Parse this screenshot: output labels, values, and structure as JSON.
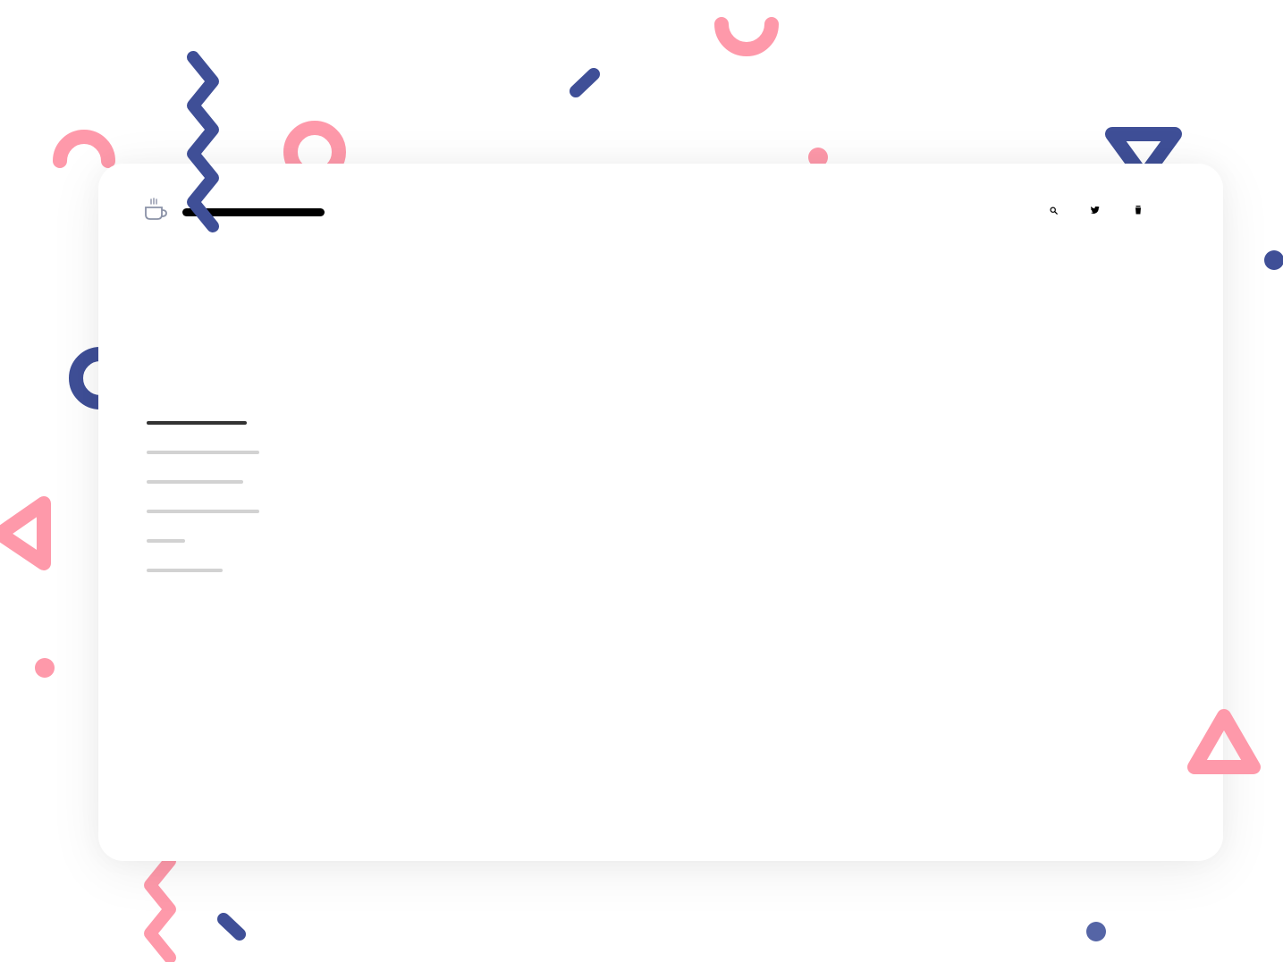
{
  "app": {
    "logo_icon": "coffee-cup-icon",
    "title_placeholder": "redacted title bar"
  },
  "header": {
    "icons": [
      "search-icon",
      "twitter-icon",
      "coffee-cup-icon"
    ]
  },
  "menu": {
    "items": [
      {
        "name": "menu-item-1",
        "state": "active"
      },
      {
        "name": "menu-item-2",
        "state": "inactive"
      },
      {
        "name": "menu-item-3",
        "state": "inactive"
      },
      {
        "name": "menu-item-4",
        "state": "inactive"
      },
      {
        "name": "menu-item-5",
        "state": "inactive"
      },
      {
        "name": "menu-item-6",
        "state": "inactive"
      }
    ]
  },
  "colors": {
    "background": "#ffffff",
    "card": "#ffffff",
    "accent_pink": "#fe99aa",
    "accent_navy": "#3f4f97",
    "text_dark": "#000000",
    "menu_active": "#333333",
    "menu_inactive": "#d2d2d2",
    "icon_gray": "#8b92a7"
  },
  "decorations": [
    "pink-arch-shape",
    "navy-zigzag-shape",
    "pink-ring-shape",
    "navy-dash-shape",
    "pink-u-shape",
    "pink-dot-shape",
    "navy-triangle-shape",
    "navy-dot-shape",
    "navy-ring-shape",
    "pink-triangle-shape",
    "pink-zigzag-shape"
  ]
}
